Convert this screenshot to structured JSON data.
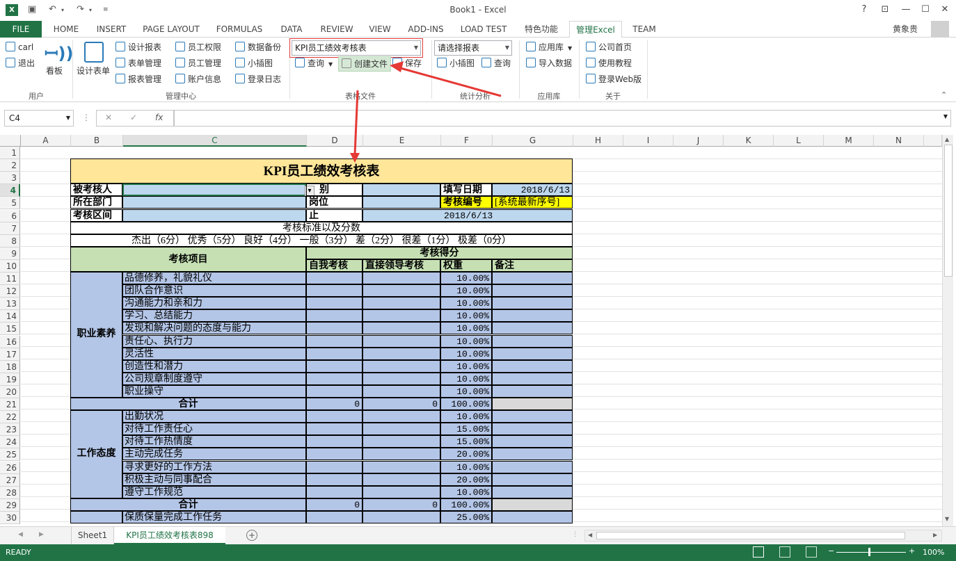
{
  "window": {
    "title": "Book1 - Excel"
  },
  "tabs": [
    "FILE",
    "HOME",
    "INSERT",
    "PAGE LAYOUT",
    "FORMULAS",
    "DATA",
    "REVIEW",
    "VIEW",
    "ADD-INS",
    "LOAD TEST",
    "特色功能",
    "管理Excel",
    "TEAM"
  ],
  "user": "黄象贵",
  "ribbon": {
    "user_group": {
      "label": "用户",
      "carl": "carl",
      "logout": "退出",
      "board": "看板"
    },
    "mgmt_group": {
      "label": "管理中心",
      "design_form": "设计表单",
      "design_report": "设计报表",
      "form_mgmt": "表单管理",
      "report_mgmt": "报表管理",
      "emp_perm": "员工权限",
      "emp_mgmt": "员工管理",
      "acct_info": "账户信息",
      "backup": "数据备份",
      "chart": "小插图",
      "login_log": "登录日志"
    },
    "file_group": {
      "label": "表格文件",
      "combo": "KPI员工绩效考核表",
      "query": "查询",
      "create": "创建文件",
      "save": "保存"
    },
    "stats_group": {
      "label": "统计分析",
      "combo": "请选择报表",
      "chart": "小插图",
      "query": "查询"
    },
    "app_group": {
      "label": "应用库",
      "applib": "应用库",
      "import": "导入数据"
    },
    "about_group": {
      "label": "关于",
      "home": "公司首页",
      "tutorial": "使用教程",
      "web": "登录Web版"
    }
  },
  "namebox": "C4",
  "fx": "fx",
  "columns": [
    "A",
    "B",
    "C",
    "D",
    "E",
    "F",
    "G",
    "H",
    "I",
    "J",
    "K",
    "L",
    "M",
    "N"
  ],
  "rows": [
    "1",
    "2",
    "3",
    "4",
    "5",
    "6",
    "7",
    "8",
    "9",
    "10",
    "11",
    "12",
    "13",
    "14",
    "15",
    "16",
    "17",
    "18",
    "19",
    "20",
    "21",
    "22",
    "23",
    "24",
    "25",
    "26",
    "27",
    "28",
    "29",
    "30"
  ],
  "sheet": {
    "title": "KPI员工绩效考核表",
    "r4": {
      "b": "被考核人",
      "d": "别",
      "f": "填写日期",
      "g": "2018/6/13"
    },
    "r5": {
      "b": "所在部门",
      "d": "岗位",
      "f": "考核编号",
      "g": "[系统最新序号]"
    },
    "r6": {
      "b": "考核区间",
      "d": "止",
      "f": "2018/6/13"
    },
    "r7": "考核标准以及分数",
    "r8": "杰出（6分） 优秀（5分） 良好（4分） 一般（3分） 差（2分） 很差（1分） 极差（0分）",
    "hdr_item": "考核项目",
    "hdr_score": "考核得分",
    "hdr_self": "自我考核",
    "hdr_leader": "直接领导考核",
    "hdr_weight": "权重",
    "hdr_note": "备注",
    "sec1": "职业素养",
    "sec1_items": [
      {
        "name": "品德修养，礼貌礼仪",
        "w": "10.00%"
      },
      {
        "name": "团队合作意识",
        "w": "10.00%"
      },
      {
        "name": "沟通能力和亲和力",
        "w": "10.00%"
      },
      {
        "name": "学习、总结能力",
        "w": "10.00%"
      },
      {
        "name": "发现和解决问题的态度与能力",
        "w": "10.00%"
      },
      {
        "name": "责任心、执行力",
        "w": "10.00%"
      },
      {
        "name": "灵活性",
        "w": "10.00%"
      },
      {
        "name": "创造性和潜力",
        "w": "10.00%"
      },
      {
        "name": "公司规章制度遵守",
        "w": "10.00%"
      },
      {
        "name": "职业操守",
        "w": "10.00%"
      }
    ],
    "total_label": "合计",
    "total1": {
      "d": "0",
      "e": "0",
      "f": "100.00%"
    },
    "sec2": "工作态度",
    "sec2_items": [
      {
        "name": "出勤状况",
        "w": "10.00%"
      },
      {
        "name": "对待工作责任心",
        "w": "15.00%"
      },
      {
        "name": "对待工作热情度",
        "w": "15.00%"
      },
      {
        "name": "主动完成任务",
        "w": "20.00%"
      },
      {
        "name": "寻求更好的工作方法",
        "w": "10.00%"
      },
      {
        "name": "积极主动与同事配合",
        "w": "20.00%"
      },
      {
        "name": "遵守工作规范",
        "w": "10.00%"
      }
    ],
    "total2": {
      "d": "0",
      "e": "0",
      "f": "100.00%"
    },
    "r30": {
      "name": "保质保量完成工作任务",
      "w": "25.00%"
    }
  },
  "sheet_tabs": [
    "Sheet1",
    "KPI员工绩效考核表898"
  ],
  "status": {
    "ready": "READY",
    "zoom": "100%"
  },
  "colors": {
    "excel_green": "#217346",
    "header_yellow": "#ffe699",
    "cell_blue": "#b4c6e7",
    "input_blue": "#bdd7ee",
    "head_green": "#c6e0b4",
    "highlight_yellow": "#ffff00",
    "red": "#e53935"
  }
}
